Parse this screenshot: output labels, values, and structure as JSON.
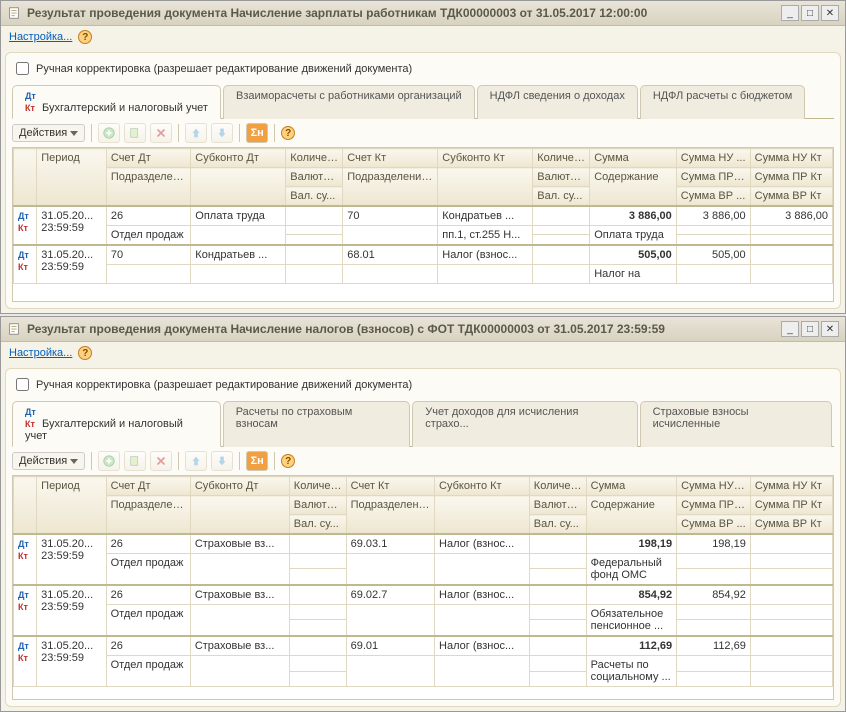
{
  "window1": {
    "title": "Результат проведения документа Начисление зарплаты работникам ТДК00000003 от 31.05.2017 12:00:00",
    "settings_label": "Настройка...",
    "checkbox_label": "Ручная корректировка (разрешает редактирование движений документа)",
    "tabs": {
      "t1": "Бухгалтерский и налоговый учет",
      "t2": "Взаиморасчеты с работниками организаций",
      "t3": "НДФЛ сведения о доходах",
      "t4": "НДФЛ расчеты с бюджетом"
    },
    "actions_label": "Действия",
    "headers": {
      "period": "Период",
      "schet_dt": "Счет Дт",
      "subkonto_dt": "Субконто Дт",
      "kolich_dt": "Количес...",
      "schet_kt": "Счет Кт",
      "subkonto_kt": "Субконто Кт",
      "kolich_kt": "Количес...",
      "summa": "Сумма",
      "summa_nu_dt": "Сумма НУ ...",
      "summa_nu_kt": "Сумма НУ Кт",
      "podrazd_dt": "Подразделение Дт",
      "valuta_dt": "Валюта ...",
      "podrazd_kt": "Подразделение Кт",
      "valuta_kt": "Валюта ...",
      "soderzh": "Содержание",
      "summa_pr_dt": "Сумма ПР ...",
      "summa_pr_kt": "Сумма ПР Кт",
      "val_sum_dt": "Вал. су...",
      "val_sum_kt": "Вал. су...",
      "summa_vr_dt": "Сумма ВР ...",
      "summa_vr_kt": "Сумма ВР Кт"
    },
    "rows": [
      {
        "date": "31.05.20...",
        "time": "23:59:59",
        "dt": "26",
        "podrazd_dt": "Отдел продаж",
        "sub_dt": "Оплата труда",
        "kt": "70",
        "sub_kt": "Кондратьев ...",
        "sub_kt2": "пп.1, ст.255 Н...",
        "sum": "3 886,00",
        "soderzh": "Оплата труда",
        "nu_dt": "3 886,00",
        "nu_kt": "3 886,00"
      },
      {
        "date": "31.05.20...",
        "time": "23:59:59",
        "dt": "70",
        "podrazd_dt": "",
        "sub_dt": "Кондратьев ...",
        "kt": "68.01",
        "sub_kt": "Налог (взнос...",
        "sum": "505,00",
        "soderzh": "Налог на",
        "nu_dt": "505,00",
        "nu_kt": ""
      }
    ]
  },
  "window2": {
    "title": "Результат проведения документа Начисление налогов (взносов) с ФОТ ТДК00000003 от 31.05.2017 23:59:59",
    "settings_label": "Настройка...",
    "checkbox_label": "Ручная корректировка (разрешает редактирование движений документа)",
    "tabs": {
      "t1": "Бухгалтерский и налоговый учет",
      "t2": "Расчеты по страховым взносам",
      "t3": "Учет доходов для исчисления страхо...",
      "t4": "Страховые взносы исчисленные"
    },
    "actions_label": "Действия",
    "headers": {
      "period": "Период",
      "schet_dt": "Счет Дт",
      "subkonto_dt": "Субконто Дт",
      "kolich_dt": "Количес...",
      "schet_kt": "Счет Кт",
      "subkonto_kt": "Субконто Кт",
      "kolich_kt": "Количес...",
      "summa": "Сумма",
      "summa_nu_dt": "Сумма НУ ...",
      "summa_nu_kt": "Сумма НУ Кт",
      "podrazd_dt": "Подразделение Дт",
      "valuta_dt": "Валюта ...",
      "podrazd_kt": "Подразделение Кт",
      "valuta_kt": "Валюта ...",
      "soderzh": "Содержание",
      "summa_pr_dt": "Сумма ПР ...",
      "summa_pr_kt": "Сумма ПР Кт",
      "val_sum_dt": "Вал. су...",
      "val_sum_kt": "Вал. су...",
      "summa_vr_dt": "Сумма ВР ...",
      "summa_vr_kt": "Сумма ВР Кт"
    },
    "rows": [
      {
        "date": "31.05.20...",
        "time": "23:59:59",
        "dt": "26",
        "podrazd_dt": "Отдел продаж",
        "sub_dt": "Страховые вз...",
        "kt": "69.03.1",
        "sub_kt": "Налог (взнос...",
        "sum": "198,19",
        "soderzh": "Федеральный фонд ОМС",
        "nu_dt": "198,19",
        "nu_kt": ""
      },
      {
        "date": "31.05.20...",
        "time": "23:59:59",
        "dt": "26",
        "podrazd_dt": "Отдел продаж",
        "sub_dt": "Страховые вз...",
        "kt": "69.02.7",
        "sub_kt": "Налог (взнос...",
        "sum": "854,92",
        "soderzh": "Обязательное пенсионное ...",
        "nu_dt": "854,92",
        "nu_kt": ""
      },
      {
        "date": "31.05.20...",
        "time": "23:59:59",
        "dt": "26",
        "podrazd_dt": "Отдел продаж",
        "sub_dt": "Страховые вз...",
        "kt": "69.01",
        "sub_kt": "Налог (взнос...",
        "sum": "112,69",
        "soderzh": "Расчеты по социальному ...",
        "nu_dt": "112,69",
        "nu_kt": ""
      }
    ]
  }
}
